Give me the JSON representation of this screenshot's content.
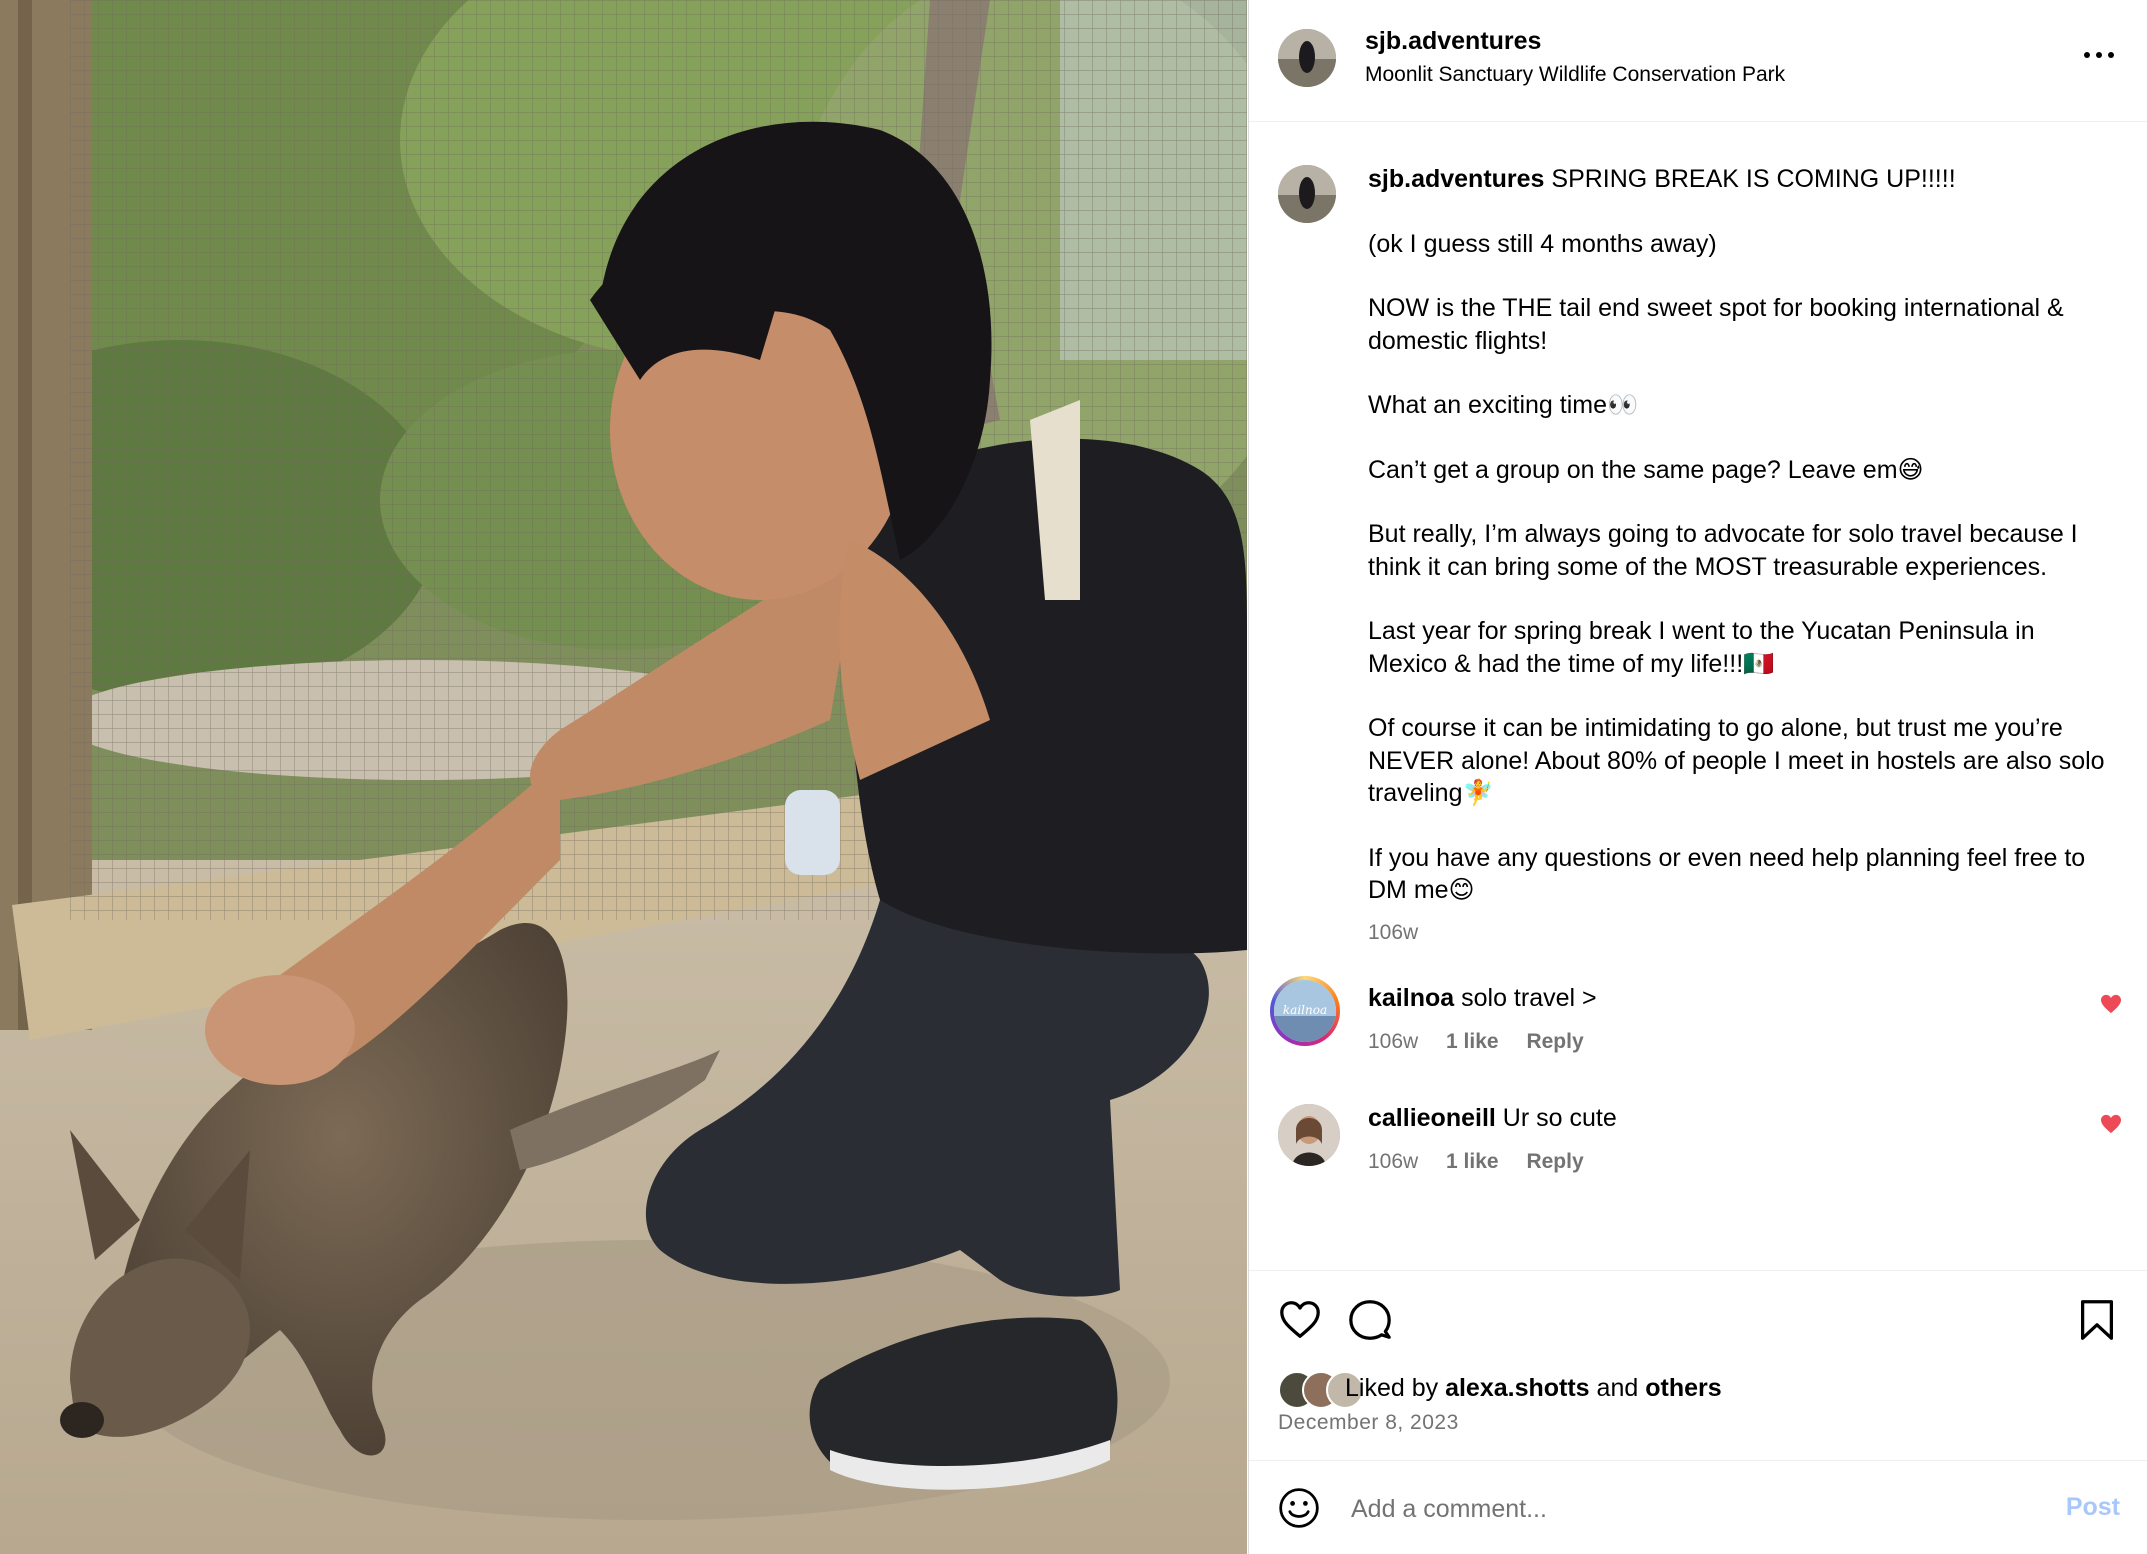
{
  "header": {
    "username": "sjb.adventures",
    "location": "Moonlit Sanctuary Wildlife Conservation Park",
    "more_icon": "more-horizontal-icon"
  },
  "caption": {
    "username": "sjb.adventures",
    "lines": [
      "SPRING BREAK IS COMING UP!!!!!",
      "(ok I guess still 4 months away)",
      "NOW is the THE tail end sweet spot for booking international & domestic flights!",
      "What an exciting time👀",
      "Can’t get a group on the same page? Leave em😅",
      "But really, I’m always going to advocate for solo travel because I think it can bring some of the MOST treasurable experiences.",
      "Last year for spring break I went to the Yucatan Peninsula in Mexico & had the time of my life!!!🇲🇽",
      "Of course it can be intimidating to go alone, but trust me you’re NEVER alone! About 80% of people I meet in hostels are also solo traveling🧚",
      "If you have any questions or even need help planning feel free to DM me😊"
    ],
    "time": "106w"
  },
  "comments": [
    {
      "username": "kailnoa",
      "text": "solo travel >",
      "time": "106w",
      "likes": "1 like",
      "reply": "Reply",
      "liked": true
    },
    {
      "username": "callieoneill",
      "text": "Ur so cute",
      "time": "106w",
      "likes": "1 like",
      "reply": "Reply",
      "liked": true
    }
  ],
  "actions": {
    "like_icon": "heart-icon",
    "comment_icon": "comment-icon",
    "save_icon": "bookmark-icon",
    "liked_by_prefix": "Liked by",
    "liked_by_user": "alexa.shotts",
    "liked_by_and": "and",
    "liked_by_others": "others",
    "date": "December 8, 2023"
  },
  "add_comment": {
    "emoji_icon": "emoji-icon",
    "placeholder": "Add a comment...",
    "post_label": "Post"
  },
  "colors": {
    "heart_red": "#ed4956",
    "muted_text": "#737373",
    "post_disabled": "#a8c7fa"
  }
}
